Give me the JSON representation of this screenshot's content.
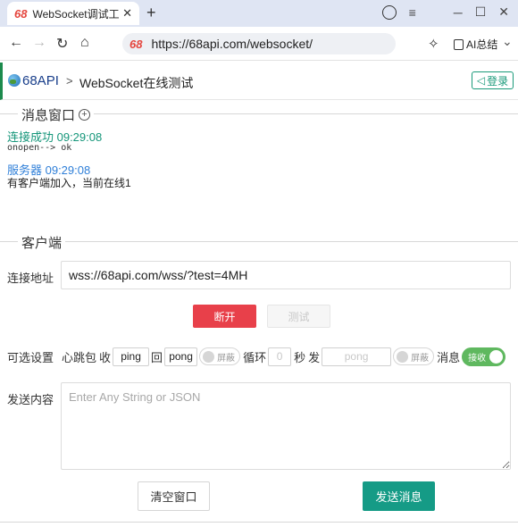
{
  "browser": {
    "tab_favicon": "68",
    "tab_title": "WebSocket调试工具",
    "tab_close": "✕",
    "new_tab": "+",
    "url_favicon": "68",
    "url": "https://68api.com/websocket/",
    "ai_summary": "AI总结"
  },
  "site": {
    "brand": "68API",
    "crumb_sep": ">",
    "crumb": "WebSocket在线测试",
    "login": "登录"
  },
  "messages": {
    "legend": "消息窗口",
    "items": [
      {
        "time": "连接成功 09:29:08",
        "type": "ok",
        "body": "onopen--> ok"
      },
      {
        "time": "服务器 09:29:08",
        "type": "server",
        "body": "有客户端加入，当前在线1"
      }
    ]
  },
  "client": {
    "legend": "客户端",
    "address_label": "连接地址",
    "address_value": "wss://68api.com/wss/?test=4MH",
    "disconnect": "断开",
    "test": "测试",
    "options_label": "可选设置",
    "heartbeat_label": "心跳包",
    "recv_label": "收",
    "recv_value": "ping",
    "reply_label": "回",
    "reply_value": "pong",
    "mask_label": "屏蔽",
    "loop_label": "循环",
    "loop_value": "0",
    "seconds_label": "秒",
    "send_label": "发",
    "send_placeholder": "pong",
    "mask2_label": "屏蔽",
    "msg_label": "消息",
    "receive_toggle": "接收",
    "receive_on": true,
    "content_label": "发送内容",
    "content_placeholder": "Enter Any String or JSON",
    "clear": "清空窗口",
    "send": "发送消息"
  },
  "colors": {
    "accent_green": "#159b86",
    "danger_red": "#e8404a",
    "server_blue": "#2f7fd8"
  }
}
